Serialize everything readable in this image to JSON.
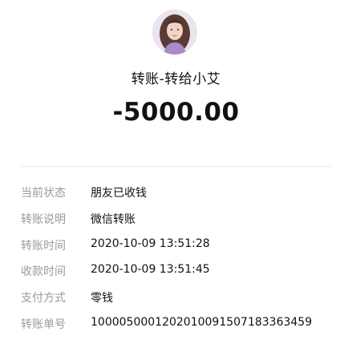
{
  "header": {
    "avatar_icon": "user-avatar-photo",
    "title": "转账-转给小艾",
    "amount": "-5000.00"
  },
  "details": [
    {
      "label": "当前状态",
      "value": "朋友已收钱"
    },
    {
      "label": "转账说明",
      "value": "微信转账"
    },
    {
      "label": "转账时间",
      "value": "2020-10-09 13:51:28"
    },
    {
      "label": "收款时间",
      "value": "2020-10-09 13:51:45"
    },
    {
      "label": "支付方式",
      "value": "零钱"
    },
    {
      "label": "转账单号",
      "value": "1000050001202010091507183363459"
    }
  ]
}
